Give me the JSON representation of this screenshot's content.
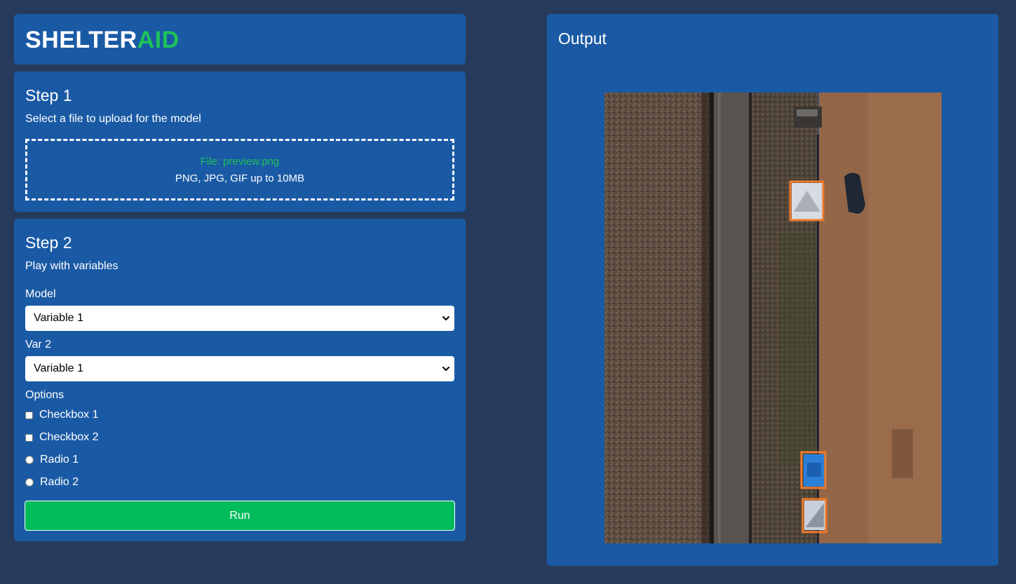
{
  "logo": {
    "part1": "SHELTER",
    "part2": "AID"
  },
  "step1": {
    "title": "Step 1",
    "subtitle": "Select a file to upload for the model",
    "file_label": "File: preview.png",
    "file_hint": "PNG, JPG, GIF up to 10MB"
  },
  "step2": {
    "title": "Step 2",
    "subtitle": "Play with variables",
    "model_label": "Model",
    "model_value": "Variable 1",
    "var2_label": "Var 2",
    "var2_value": "Variable 1",
    "options_label": "Options",
    "checkbox1": "Checkbox 1",
    "checkbox2": "Checkbox 2",
    "radio1": "Radio 1",
    "radio2": "Radio 2",
    "run_label": "Run"
  },
  "output": {
    "title": "Output"
  },
  "colors": {
    "background": "#263b5c",
    "panel": "#1a5aa5",
    "accent_green": "#1ec25b",
    "run_button": "#00bc5a",
    "detection_box": "#f07a2a"
  }
}
